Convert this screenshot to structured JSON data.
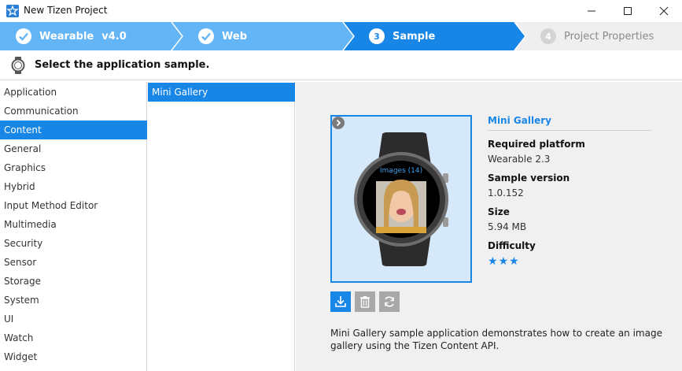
{
  "window": {
    "title": "New Tizen Project",
    "controls": [
      "minimize",
      "maximize",
      "close"
    ]
  },
  "wizard": {
    "steps": [
      {
        "label": "Wearable",
        "extra": "v4.0",
        "state": "done",
        "number": "1"
      },
      {
        "label": "Web",
        "state": "done",
        "number": "2"
      },
      {
        "label": "Sample",
        "state": "current",
        "number": "3"
      },
      {
        "label": "Project Properties",
        "state": "future",
        "number": "4"
      }
    ],
    "colors": {
      "done": "#64b5f6",
      "current": "#1886e6",
      "future": "#efefef"
    }
  },
  "instruction": {
    "text": "Select the application sample.",
    "icon": "watch-icon"
  },
  "categories": {
    "items": [
      "Application",
      "Communication",
      "Content",
      "General",
      "Graphics",
      "Hybrid",
      "Input Method Editor",
      "Multimedia",
      "Security",
      "Sensor",
      "Storage",
      "System",
      "UI",
      "Watch",
      "Widget"
    ],
    "selected": "Content"
  },
  "samples": {
    "items": [
      "Mini Gallery"
    ],
    "selected": "Mini Gallery"
  },
  "detail": {
    "preview_label": "Images (14)",
    "name": "Mini Gallery",
    "platform_label": "Required platform",
    "platform_value": "Wearable 2.3",
    "version_label": "Sample version",
    "version_value": "1.0.152",
    "size_label": "Size",
    "size_value": "5.94 MB",
    "difficulty_label": "Difficulty",
    "difficulty_stars": 3,
    "actions": [
      "download-icon",
      "trash-icon",
      "refresh-icon"
    ],
    "description": "Mini Gallery sample application demonstrates how to create an image gallery using the Tizen Content API."
  }
}
